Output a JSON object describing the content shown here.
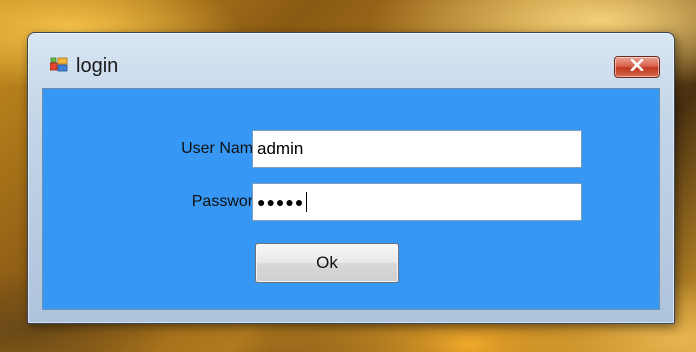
{
  "window": {
    "title": "login",
    "close_label": "X"
  },
  "form": {
    "username_label": "User Name",
    "username_value": "admin",
    "password_label": "Password",
    "password_masked": "●●●●●"
  },
  "buttons": {
    "ok_label": "Ok"
  },
  "colors": {
    "client_background": "#3797f5",
    "close_button": "#c0391f"
  },
  "icons": {
    "title": "form-window-icon",
    "close": "close-icon"
  }
}
